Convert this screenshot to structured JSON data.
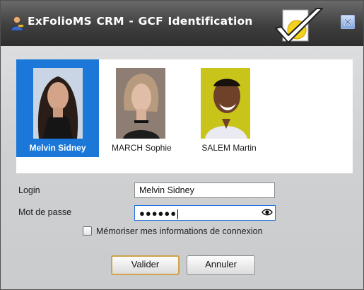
{
  "window": {
    "title": "ExFolioMS CRM - GCF  Identification",
    "close_icon": "close-icon",
    "accent": "#1c78d8"
  },
  "users": [
    {
      "name": "Melvin Sidney",
      "selected": true
    },
    {
      "name": "MARCH Sophie",
      "selected": false
    },
    {
      "name": "SALEM Martin",
      "selected": false
    }
  ],
  "form": {
    "login_label": "Login",
    "login_value": "Melvin Sidney",
    "password_label": "Mot de passe",
    "password_value": "●●●●●●",
    "remember_label": "Mémoriser mes informations de connexion",
    "remember_checked": false
  },
  "buttons": {
    "ok_label": "Valider",
    "cancel_label": "Annuler"
  }
}
